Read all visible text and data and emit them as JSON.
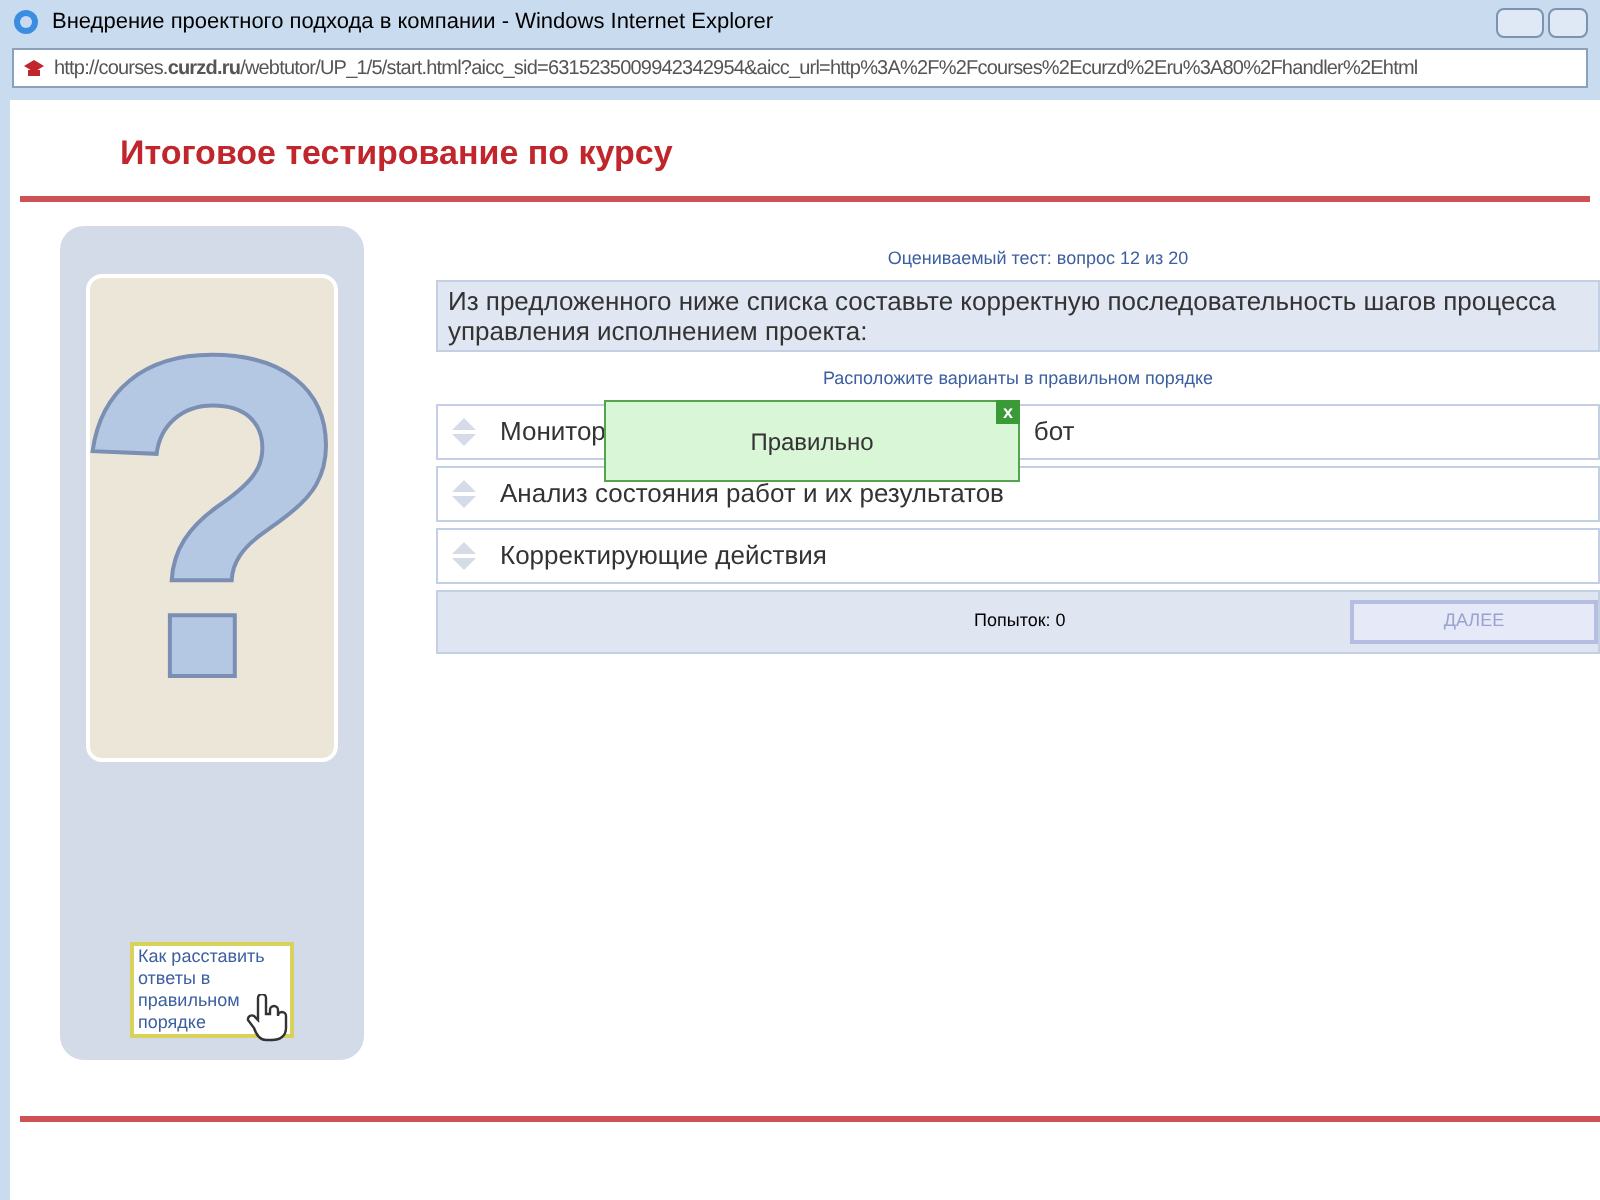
{
  "window": {
    "title": "Внедрение проектного подхода в компании - Windows Internet Explorer"
  },
  "address": "http://courses.**curzd.ru**/webtutor/UP_1/5/start.html?aicc_sid=6315235009942342954&aicc_url=http%3A%2F%2Fcourses%2Ecurzd%2Eru%3A80%2Fhandler%2Ehtml",
  "header": "Итоговое тестирование по курсу",
  "sidebar": {
    "symbol": "?",
    "hint": "Как расставить ответы в правильном порядке"
  },
  "test": {
    "progress": "Оцениваемый тест: вопрос 12 из 20",
    "question": "Из предложенного ниже списка составьте корректную последовательность шагов процесса управления исполнением проекта:",
    "instruction": "Расположите варианты в правильном порядке",
    "items": [
      {
        "parts": [
          "Монитор",
          "бот"
        ]
      },
      {
        "parts": [
          "Анализ состояния работ и их результатов"
        ]
      },
      {
        "parts": [
          "Корректирующие действия"
        ]
      }
    ],
    "attempts": "Попыток: 0",
    "next_button": {
      "label": "ДАЛЕЕ",
      "disabled": true
    }
  },
  "popup": {
    "message": "Правильно",
    "close": "x"
  }
}
